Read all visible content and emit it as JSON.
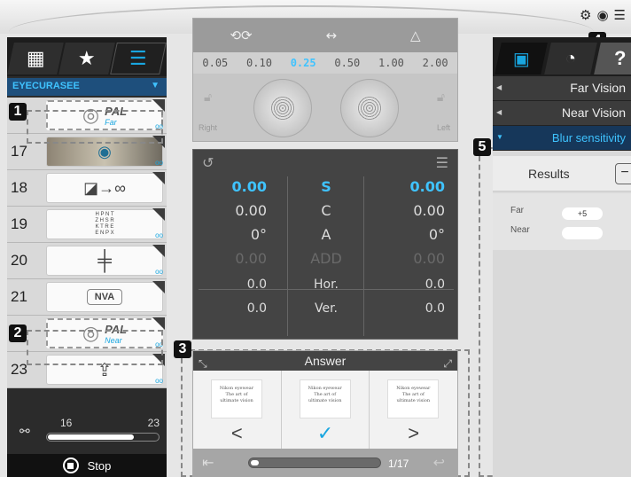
{
  "left_panel": {
    "tabs": [
      {
        "icon": "grid-icon",
        "glyph": "▦"
      },
      {
        "icon": "star-icon",
        "glyph": "★"
      },
      {
        "icon": "list-icon",
        "glyph": "☰"
      }
    ],
    "dropdown": {
      "value": "EYECURASEE",
      "arrow": "▼"
    },
    "rows": [
      {
        "num": "16",
        "kind": "pal",
        "label": "PAL",
        "sub": "Far",
        "selected": true
      },
      {
        "num": "17",
        "kind": "image",
        "label": ""
      },
      {
        "num": "18",
        "kind": "text",
        "label": "◪→∞"
      },
      {
        "num": "19",
        "kind": "chart",
        "label": "H P N T\nZ H S R\nK T R E\nE N P X"
      },
      {
        "num": "20",
        "kind": "text",
        "label": "╪"
      },
      {
        "num": "21",
        "kind": "text",
        "label": "NVA"
      },
      {
        "num": "22",
        "kind": "pal",
        "label": "PAL",
        "sub": "Near",
        "selected": true
      },
      {
        "num": "23",
        "kind": "text",
        "label": "⇪"
      }
    ],
    "counter": {
      "start": "16",
      "end": "23",
      "progress": 0.78
    },
    "stop_label": "Stop"
  },
  "markers": [
    "1",
    "2",
    "3",
    "4",
    "5"
  ],
  "top_icons": [
    "⚙",
    "◉",
    "☰"
  ],
  "center_top": {
    "icons": [
      "⟲⟳",
      "↔",
      "△"
    ],
    "scale": [
      "0.05",
      "0.10",
      "0.25",
      "0.50",
      "1.00",
      "2.00"
    ],
    "selected_scale": "0.25",
    "right_label": "Right",
    "left_label": "Left"
  },
  "center_mid": {
    "rows": [
      {
        "l": "0.00",
        "m": "S",
        "r": "0.00",
        "style": "hl"
      },
      {
        "l": "0.00",
        "m": "C",
        "r": "0.00",
        "style": ""
      },
      {
        "l": "0°",
        "m": "A",
        "r": "0°",
        "style": ""
      },
      {
        "l": "0.00",
        "m": "ADD",
        "r": "0.00",
        "style": "dim"
      },
      {
        "l": "0.0",
        "m": "Hor.",
        "r": "0.0",
        "style": "sm"
      },
      {
        "l": "0.0",
        "m": "Ver.",
        "r": "0.0",
        "style": "sm"
      }
    ]
  },
  "answer": {
    "title": "Answer",
    "card_text": [
      "Nikon eyewear",
      "The art of",
      "ultimate vision"
    ],
    "nav": [
      "<",
      "✓",
      ">"
    ],
    "progress": 0.06,
    "count": "1/17"
  },
  "right_panel": {
    "menu": [
      {
        "label": "Far Vision",
        "hl": false
      },
      {
        "label": "Near Vision",
        "hl": false
      },
      {
        "label": "Blur sensitivity",
        "hl": true
      }
    ],
    "results_title": "Results",
    "results": [
      {
        "label": "Far",
        "value": "+5"
      },
      {
        "label": "Near",
        "value": ""
      }
    ]
  }
}
